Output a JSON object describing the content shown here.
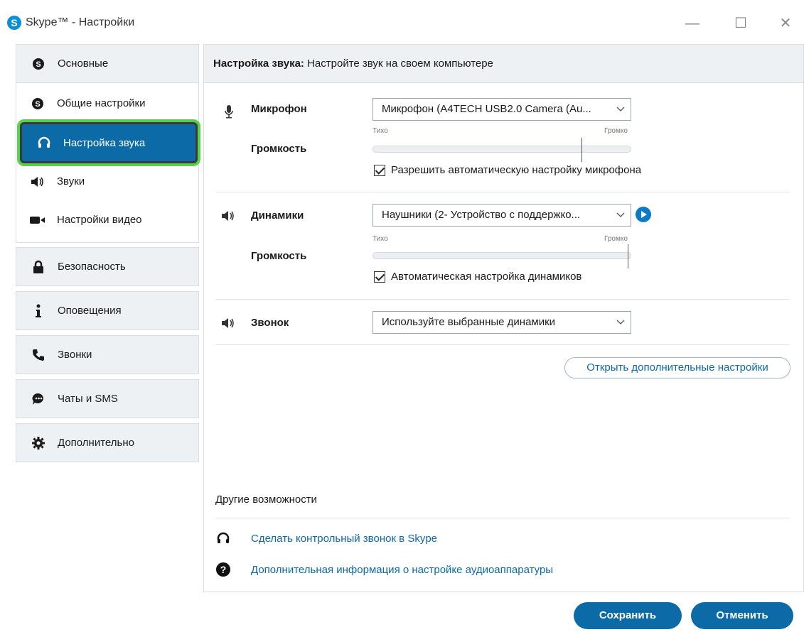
{
  "window": {
    "title": "Skype™ - Настройки",
    "logo_letter": "S",
    "minimize": "—",
    "maximize": "☐",
    "close": "✕"
  },
  "sidebar": {
    "sections": [
      {
        "label": "Основные",
        "icon": "skype-icon",
        "glyph": "S"
      },
      {
        "label": "Безопасность",
        "icon": "lock-icon",
        "glyph": "🔒"
      },
      {
        "label": "Оповещения",
        "icon": "info-icon",
        "glyph": "i"
      },
      {
        "label": "Звонки",
        "icon": "phone-icon",
        "glyph": "✆"
      },
      {
        "label": "Чаты и SMS",
        "icon": "chat-icon",
        "glyph": "◕"
      },
      {
        "label": "Дополнительно",
        "icon": "gear-icon",
        "glyph": "⚙"
      }
    ],
    "sub_items": [
      {
        "label": "Общие настройки",
        "icon": "skype-icon",
        "glyph": "S"
      },
      {
        "label": "Настройка звука",
        "icon": "headset-icon",
        "glyph": "◠",
        "active": true
      },
      {
        "label": "Звуки",
        "icon": "speaker-icon",
        "glyph": "◀)"
      },
      {
        "label": "Настройки видео",
        "icon": "video-camera-icon",
        "glyph": "■◂"
      }
    ]
  },
  "panel": {
    "header_bold": "Настройка звука:",
    "header_rest": " Настройте звук на своем компьютере",
    "microphone": {
      "label": "Микрофон",
      "device": "Микрофон (A4TECH USB2.0 Camera (Au...",
      "volume_label": "Громкость",
      "quiet": "Тихо",
      "loud": "Громко",
      "level": 0.81,
      "auto_checkbox": "Разрешить автоматическую настройку микрофона",
      "auto_checked": true
    },
    "speakers": {
      "label": "Динамики",
      "device": "Наушники (2- Устройство с поддержко...",
      "volume_label": "Громкость",
      "quiet": "Тихо",
      "loud": "Громко",
      "level": 0.99,
      "auto_checkbox": "Автоматическая настройка динамиков",
      "auto_checked": true
    },
    "ring": {
      "label": "Звонок",
      "device": "Используйте выбранные динамики"
    },
    "advanced_button": "Открыть дополнительные настройки",
    "other_title": "Другие возможности",
    "links": [
      {
        "text": "Сделать контрольный звонок в Skype",
        "icon": "headset-icon"
      },
      {
        "text": "Дополнительная информация о настройке аудиоаппаратуры",
        "icon": "question-icon"
      }
    ]
  },
  "buttons": {
    "save": "Сохранить",
    "cancel": "Отменить"
  },
  "colors": {
    "accent": "#0c6aa6",
    "highlight": "#55d14a",
    "header_bg": "#eef1f4"
  }
}
